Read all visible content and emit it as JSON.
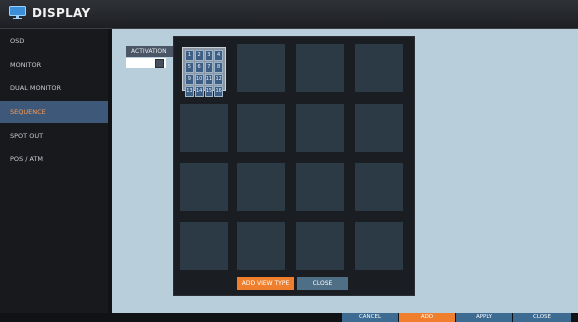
{
  "header": {
    "title": "DISPLAY",
    "icon": "monitor-icon"
  },
  "sidebar": {
    "items": [
      {
        "label": "OSD"
      },
      {
        "label": "MONITOR"
      },
      {
        "label": "DUAL MONITOR"
      },
      {
        "label": "SEQUENCE",
        "active": true
      },
      {
        "label": "SPOT OUT"
      },
      {
        "label": "POS / ATM"
      }
    ]
  },
  "main": {
    "activation_label": "ACTIVATION"
  },
  "modal": {
    "channels": [
      "1",
      "2",
      "3",
      "4",
      "5",
      "6",
      "7",
      "8",
      "9",
      "10",
      "11",
      "12",
      "13",
      "14",
      "15",
      "16"
    ],
    "add_view_type_label": "ADD VIEW TYPE",
    "close_label": "CLOSE"
  },
  "footer": {
    "cancel_label": "CANCEL",
    "add_label": "ADD",
    "apply_label": "APPLY",
    "close_label": "CLOSE"
  },
  "colors": {
    "accent_orange": "#ef7f2c",
    "button_blue": "#3d6b92",
    "sidebar_active": "#3e5879",
    "panel_bg": "#b9cedb"
  }
}
